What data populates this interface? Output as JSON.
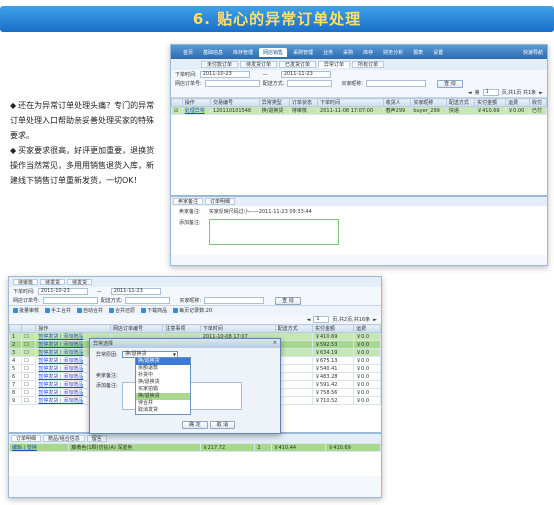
{
  "banner": {
    "title": "6. 贴心的异常订单处理"
  },
  "description": {
    "bullets": [
      "还在为异常订单处理头痛？专门的异常订单处理入口帮助亲妥善处理买家的特殊要求。",
      "买家要求很高，好评更加重要，退换货操作当然常见，多用用销售退货入库，新建线下销售订单重新发货，一切OK！"
    ],
    "bullet_glyph": "◆"
  },
  "window1": {
    "menu": [
      "首页",
      "基础信息",
      "库存管理",
      "网店销售",
      "采购管理",
      "业务",
      "采购",
      "库存",
      "财务分析",
      "报表",
      "设置"
    ],
    "active_menu": "网店销售",
    "quick_link": "快速导航",
    "subtabs": [
      "未付款订单",
      "待发货订单",
      "已发货订单",
      "异常订单",
      "所有订单"
    ],
    "active_subtab": "异常订单",
    "filters": {
      "order_time_label": "下单时间:",
      "date_from": "2011-10-23",
      "date_sep": "—",
      "date_to": "2011-11-23",
      "website_order_label": "网店订单号:",
      "delivery_label": "配送方式:",
      "buyer_label": "买家昵称:",
      "search_btn": "查 询"
    },
    "pager": {
      "first": "◄",
      "page_label": "第",
      "page": "1",
      "total": "页,共1页 共1条",
      "next": "►"
    },
    "columns": [
      "",
      "操作",
      "交易编号",
      "异常类型",
      "订单状态",
      "下单时间",
      "收货人",
      "买家昵称",
      "配送方式",
      "实付金额",
      "运费",
      "收付"
    ],
    "rows": [
      {
        "check": "☑",
        "op": "处理异常",
        "trade_no": "120110101548",
        "type": "换/退换货",
        "status": "待审核",
        "time": "2011-11-08 17:07:00",
        "receiver": "春声299",
        "buyer": "buyer_299",
        "delivery": "快递",
        "paid": "￥410.69",
        "freight": "￥0.00",
        "pay": "已付"
      }
    ],
    "detail_tabs": [
      "卖家备注",
      "订单明细"
    ],
    "active_detail_tab": "卖家备注",
    "seller_note_label": "卖家备注:",
    "seller_note_value": "买家反映尺码过小——2011-11-23 09:33:44",
    "add_note_label": "添加备注:"
  },
  "window2": {
    "tabs": [
      "待审核",
      "待发货",
      "待发货"
    ],
    "filters": {
      "order_time_label": "下单时间:",
      "date_from": "2011-10-23",
      "date_to": "2011-11-23",
      "website_order_label": "网店订单号:",
      "delivery_label": "配送方式:",
      "buyer_label": "买家昵称:",
      "search_btn": "查 询"
    },
    "toolbar": [
      "批量审核",
      "手工合并",
      "自动合并",
      "合并还原",
      "下载商品",
      "每页记录数:20"
    ],
    "pager": {
      "page": "1",
      "total": "页,共2页,共16条"
    },
    "columns": [
      "",
      "",
      "操作",
      "网店订单编号",
      "注意事项",
      "下单时间",
      "配送方式",
      "实付金额",
      "运费"
    ],
    "rows": [
      {
        "n": "1",
        "op": "暂停发货 | 添加赠品",
        "hl": "hl",
        "time": "2011-10-08 17:07",
        "paid": "￥410.69",
        "fee": "￥0.0"
      },
      {
        "n": "2",
        "op": "暂停发货 | 添加赠品",
        "hl": "hl2",
        "time": "",
        "paid": "￥592.53",
        "fee": "￥0.0"
      },
      {
        "n": "3",
        "op": "暂停发货 | 添加赠品",
        "hl": "hl",
        "time": "",
        "paid": "￥634.19",
        "fee": "￥0.0"
      },
      {
        "n": "4",
        "op": "暂停发货 | 添加赠品",
        "hl": "",
        "time": "",
        "paid": "￥675.13",
        "fee": "￥0.0"
      },
      {
        "n": "5",
        "op": "暂停发货 | 添加赠品",
        "hl": "",
        "time": "",
        "paid": "￥540.41",
        "fee": "￥0.0"
      },
      {
        "n": "6",
        "op": "暂停发货 | 添加赠品",
        "hl": "",
        "time": "",
        "paid": "￥483.28",
        "fee": "￥0.0"
      },
      {
        "n": "7",
        "op": "暂停发货 | 添加赠品",
        "hl": "",
        "time": "",
        "paid": "￥591.42",
        "fee": "￥0.0"
      },
      {
        "n": "8",
        "op": "暂停发货 | 添加赠品",
        "hl": "",
        "time": "",
        "paid": "￥758.56",
        "fee": "￥0.0"
      },
      {
        "n": "9",
        "op": "暂停发货 | 添加赠品",
        "hl": "",
        "time": "",
        "paid": "￥710.52",
        "fee": "￥0.0"
      }
    ],
    "bottom_tabs": [
      "订单明细",
      "赠品/组合信息",
      "留言"
    ],
    "bottom_row": {
      "op": "编辑 | 替换",
      "item": "藤黄色(1颗)仿钻(A) 深蓝色",
      "price": "￥217.72",
      "qty": "2",
      "total": "￥410.44",
      "paid": "￥410.69"
    }
  },
  "dialog": {
    "title": "异常选择",
    "close": "×",
    "reason_label": "异常原因:",
    "reason_selected": "换/退换货",
    "seller_note_label": "卖家备注:",
    "add_note_label": "添加备注:",
    "options": [
      "换/退换货",
      "余额退款",
      "补货中",
      "换/退换货",
      "买家拍错",
      "换/退换货",
      "待合并",
      "取消发货"
    ],
    "confirm": "确 定",
    "cancel": "取 消"
  },
  "colors": {
    "banner": "#1a6fc9",
    "banner_text": "#ffe066",
    "row_highlight": "#a7d88e"
  }
}
